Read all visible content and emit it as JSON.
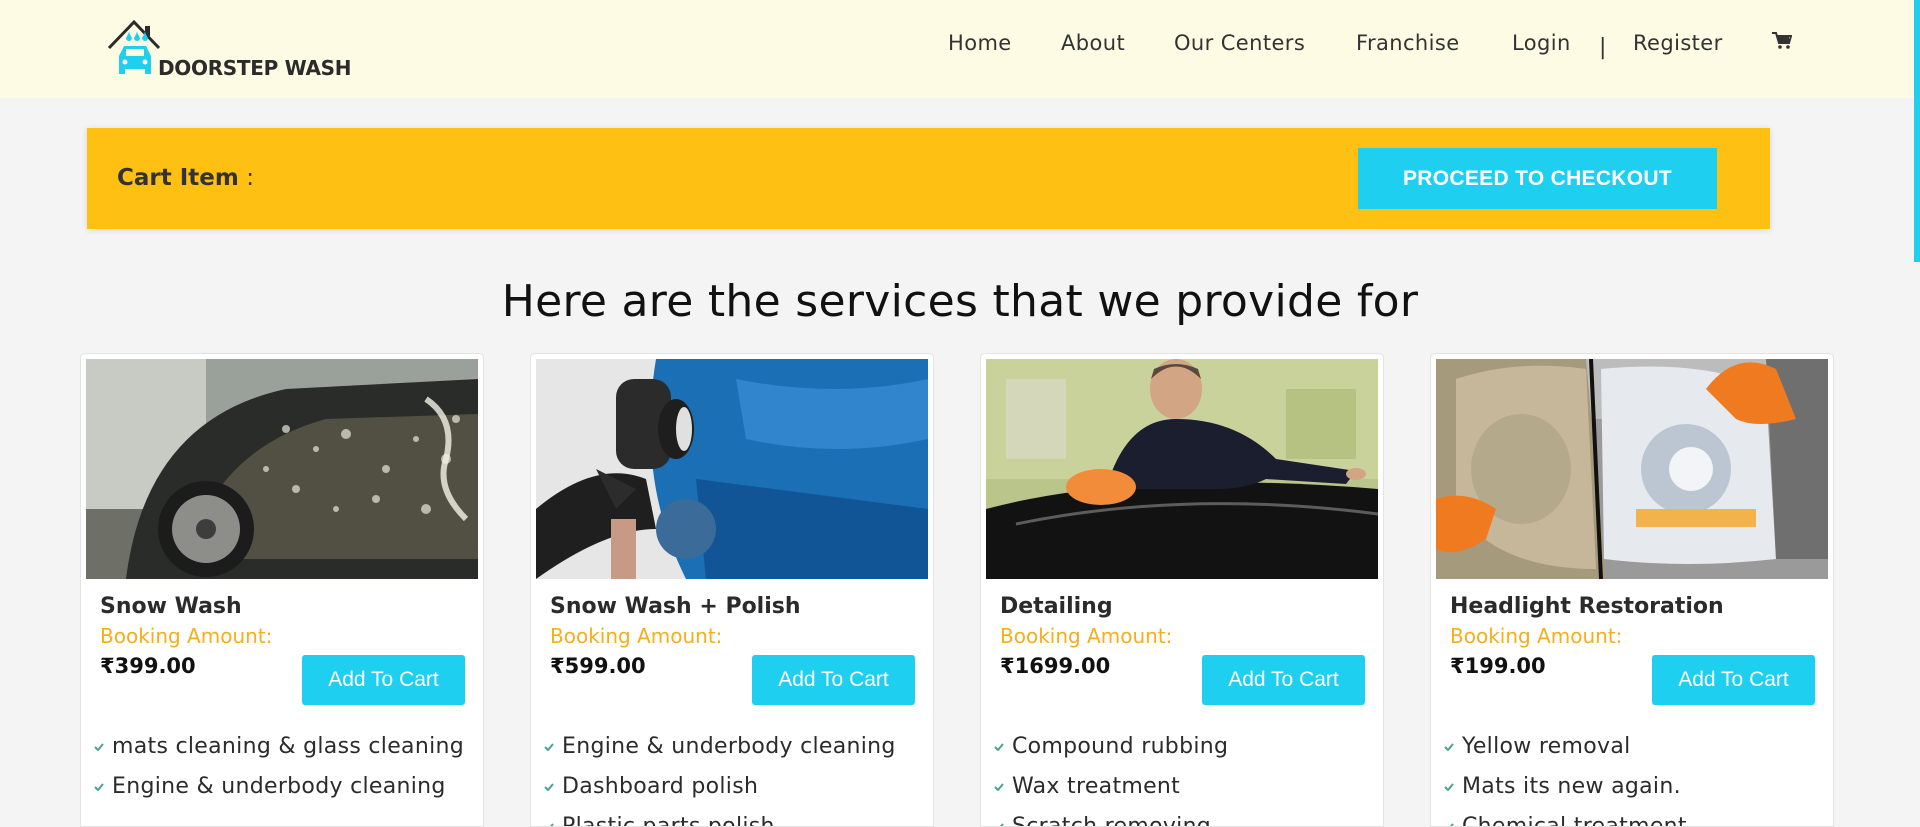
{
  "brand": {
    "name": "DOORSTEP WASH",
    "logo_icon": "house-car-icon",
    "accent": "#1ecfef"
  },
  "nav": {
    "items": [
      "Home",
      "About",
      "Our Centers",
      "Franchise",
      "Login",
      "Register"
    ],
    "separator": "|",
    "cart_icon": "shopping-cart-icon"
  },
  "cart_bar": {
    "label": "Cart Item",
    "suffix": ":",
    "checkout_label": "Proceed to checkout",
    "background": "#fec113"
  },
  "section": {
    "heading": "Here are the services that we provide for"
  },
  "services": [
    {
      "title": "Snow Wash",
      "booking_label": "Booking Amount:",
      "price": "₹399.00",
      "button_label": "Add To Cart",
      "image": "car-foam-wash-photo",
      "features": [
        "mats cleaning & glass cleaning",
        "Engine & underbody cleaning"
      ]
    },
    {
      "title": "Snow Wash + Polish",
      "booking_label": "Booking Amount:",
      "price": "₹599.00",
      "button_label": "Add To Cart",
      "image": "car-polishing-photo",
      "features": [
        "Engine & underbody cleaning",
        "Dashboard polish",
        "Plastic parts polish"
      ]
    },
    {
      "title": "Detailing",
      "booking_label": "Booking Amount:",
      "price": "₹1699.00",
      "button_label": "Add To Cart",
      "image": "car-detailing-photo",
      "features": [
        "Compound rubbing",
        "Wax treatment",
        "Scratch removing"
      ]
    },
    {
      "title": "Headlight Restoration",
      "booking_label": "Booking Amount:",
      "price": "₹199.00",
      "button_label": "Add To Cart",
      "image": "headlight-restoration-photo",
      "features": [
        "Yellow removal",
        "Mats its new again.",
        "Chemical treatment"
      ]
    }
  ]
}
